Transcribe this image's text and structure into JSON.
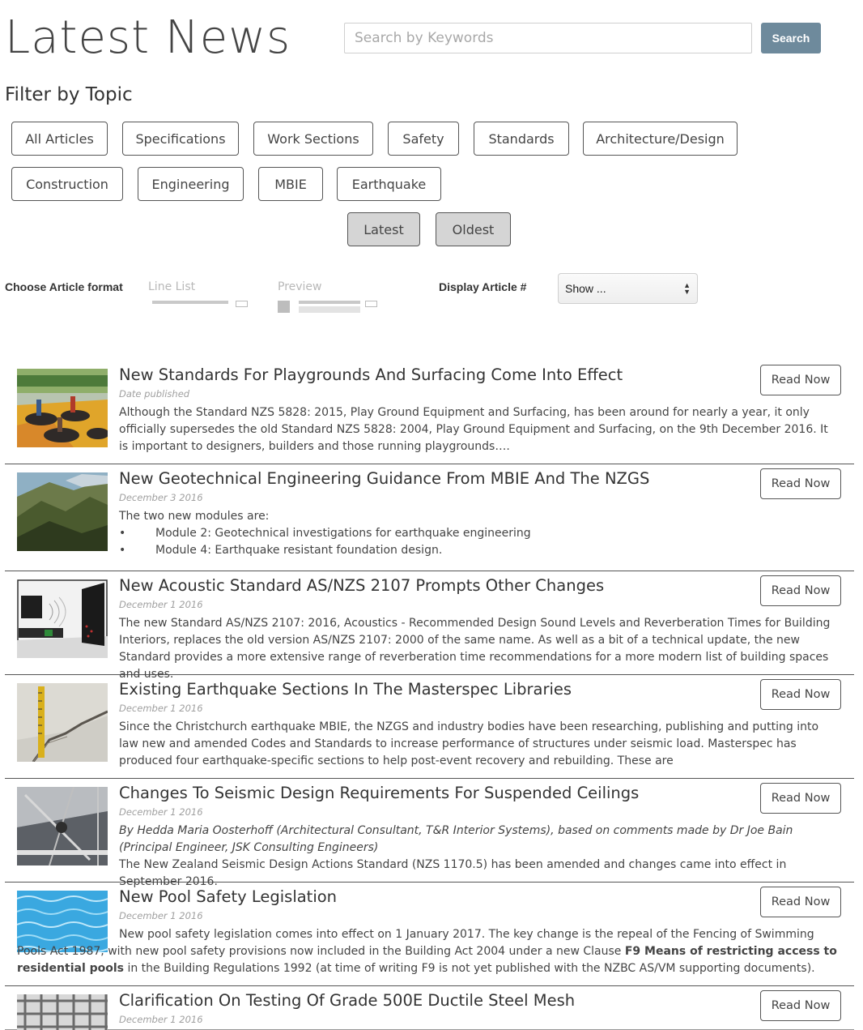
{
  "header": {
    "title": "Latest News",
    "search_placeholder": "Search by Keywords",
    "search_value": "",
    "search_button": "Search"
  },
  "filter": {
    "heading": "Filter by Topic",
    "topics": [
      "All Articles",
      "Specifications",
      "Work Sections",
      "Safety",
      "Standards",
      "Architecture/Design",
      "Construction",
      "Engineering",
      "MBIE",
      "Earthquake"
    ],
    "sort": [
      "Latest",
      "Oldest"
    ]
  },
  "format": {
    "label": "Choose Article format",
    "options": [
      "Line List",
      "Preview"
    ],
    "display_label": "Display Article #",
    "display_value": "Show ..."
  },
  "colors": {
    "search_button": "#6e8a9c",
    "sort_bg": "#d5d5d5",
    "divider": "#555555"
  },
  "articles": [
    {
      "title": "New Standards For Playgrounds And Surfacing Come Into Effect",
      "date": "Date published",
      "body": "Although the Standard NZS 5828: 2015, Play Ground Equipment and Surfacing, has been around for nearly a year, it only officially supersedes the old Standard NZS 5828: 2004, Play Ground Equipment and Surfacing, on the 9th December 2016. It is important to designers, builders and those running playgrounds….",
      "button": "Read Now",
      "thumb": "playground-image"
    },
    {
      "title": "New Geotechnical Engineering Guidance From MBIE And The NZGS",
      "date": "December 3 2016",
      "intro": "The two new modules are:",
      "bullets": [
        "Module 2: Geotechnical investigations for earthquake engineering",
        "Module 4: Earthquake resistant foundation design."
      ],
      "bullet_char": "•",
      "button": "Read Now",
      "thumb": "mountains-image"
    },
    {
      "title": "New Acoustic Standard AS/NZS 2107 Prompts Other Changes",
      "date": "December 1 2016",
      "body": "The new Standard AS/NZS 2107: 2016, Acoustics - Recommended Design Sound Levels and Reverberation Times for Building Interiors, replaces the old version AS/NZS 2107: 2000 of the same name. As well as a bit of a technical update, the new Standard provides a more extensive range of reverberation time recommendations for a more modern list of building spaces and uses.",
      "button": "Read Now",
      "thumb": "acoustic-room-image"
    },
    {
      "title": "Existing Earthquake Sections In The Masterspec Libraries",
      "date": "December 1 2016",
      "body": "Since the Christchurch earthquake MBIE, the NZGS and industry bodies have been researching, publishing and putting into law new and amended Codes and Standards to increase performance of structures under seismic load. Masterspec has produced four earthquake-specific sections to help post-event recovery and rebuilding. These are",
      "button": "Read Now",
      "thumb": "crack-ruler-image"
    },
    {
      "title": "Changes To Seismic Design Requirements For Suspended Ceilings",
      "date": "December 1 2016",
      "italic": "By Hedda Maria Oosterhoff (Architectural Consultant, T&R Interior Systems), based on comments made by Dr Joe Bain (Principal Engineer, JSK Consulting Engineers)",
      "body": "The New Zealand Seismic Design Actions Standard (NZS 1170.5) has been amended and changes came into effect in September 2016.",
      "button": "Read Now",
      "thumb": "ceiling-image"
    },
    {
      "title": "New Pool Safety Legislation",
      "date": "December 1 2016",
      "body_a": "New pool safety legislation comes into effect on 1 January 2017. The key change is the repeal of the Fencing of Swimming Pools Act 1987, with new pool safety provisions now included in the Building Act 2004 under a new Clause ",
      "body_bold": "F9 Means of restricting access to residential pools",
      "body_b": " in the Building Regulations 1992 (at time of writing F9 is not yet published with the NZBC AS/VM supporting documents).",
      "button": "Read Now",
      "thumb": "pool-water-image"
    },
    {
      "title": "Clarification On Testing Of Grade 500E Ductile Steel Mesh",
      "date": "December 1 2016",
      "button": "Read Now",
      "thumb": "steel-mesh-image"
    }
  ]
}
